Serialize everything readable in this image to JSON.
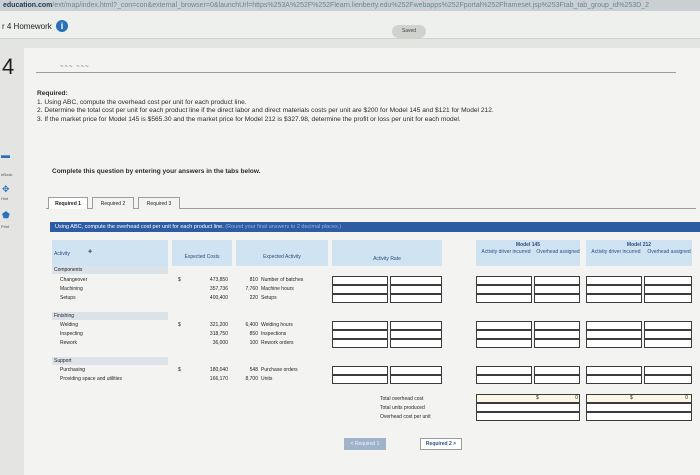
{
  "browser": {
    "url_site": "education.com",
    "url_rest": "/ext/map/index.html?_con=con&external_browser=0&launchUrl=https%253A%252F%252Flearn.lienberty.edu%252Fwebapps%252Fportal%252Fframeset.jsp%253Ftab_tab_group_id%253D_2"
  },
  "header": {
    "title": "r 4 Homework",
    "info_icon": "i",
    "saved_badge": "Saved"
  },
  "sidebar": {
    "question_number": "4",
    "items": [
      {
        "icon": "book-icon",
        "glyph": "▬",
        "label": "eBook"
      },
      {
        "icon": "hint-icon",
        "glyph": "✥",
        "label": "Hint"
      },
      {
        "icon": "print-icon",
        "glyph": "⬟",
        "label": "Print"
      }
    ]
  },
  "question": {
    "prev_fragment": "~~~   ~~~",
    "heading": "Required:",
    "lines": [
      "1. Using ABC, compute the overhead cost per unit for each product line.",
      "2. Determine the total cost per unit for each product line if the direct labor and direct materials costs per unit are $200 for Model 145 and $121 for Model 212.",
      "3. If the market price for Model 145 is $565.30 and the market price for Model 212 is $327.98, determine the profit or loss per unit for each model."
    ]
  },
  "instruction": "Complete this question by entering your answers in the tabs below.",
  "tabs": [
    {
      "label": "Required 1",
      "active": true
    },
    {
      "label": "Required 2",
      "active": false
    },
    {
      "label": "Required 3",
      "active": false
    }
  ],
  "prompt": {
    "text": "Using ABC, compute the overhead cost per unit for each product line.",
    "hint": "(Round your final answers to 2 decimal places.)"
  },
  "table": {
    "headers": {
      "activity": "Activity",
      "expected_costs": "Expected Costs",
      "expected_activity": "Expected Activity",
      "activity_rate": "Activity Rate",
      "model_145": "Model 145",
      "model_212": "Model 212",
      "driver_incurred": "Activity driver incurred",
      "overhead_assigned": "Overhead assigned"
    },
    "rows": [
      {
        "label": "Components",
        "category": true
      },
      {
        "label": "Changeover",
        "cost": "473,850",
        "qty": "810",
        "unit": "Number of batches",
        "dollar": true
      },
      {
        "label": "Machining",
        "cost": "357,736",
        "qty": "7,760",
        "unit": "Machine hours"
      },
      {
        "label": "Setups",
        "cost": "400,400",
        "qty": "220",
        "unit": "Setups"
      },
      {
        "label": "Finishing",
        "category": true
      },
      {
        "label": "Welding",
        "cost": "321,200",
        "qty": "6,400",
        "unit": "Welding hours",
        "dollar": true
      },
      {
        "label": "Inspecting",
        "cost": "318,750",
        "qty": "850",
        "unit": "Inspections"
      },
      {
        "label": "Rework",
        "cost": "36,000",
        "qty": "100",
        "unit": "Rework orders"
      },
      {
        "label": "Support",
        "category": true
      },
      {
        "label": "Purchasing",
        "cost": "180,040",
        "qty": "548",
        "unit": "Purchase orders",
        "dollar": true
      },
      {
        "label": "Providing space and utilities",
        "cost": "166,170",
        "qty": "8,700",
        "unit": "Units"
      }
    ],
    "totals": {
      "labels": [
        "Total overhead cost",
        "Total units produced",
        "Overhead cost per unit"
      ],
      "dollar": "$",
      "model_145_total": "0",
      "model_212_total": "0"
    }
  },
  "nav": {
    "prev": "< Required 1",
    "next": "Required 2 >"
  }
}
